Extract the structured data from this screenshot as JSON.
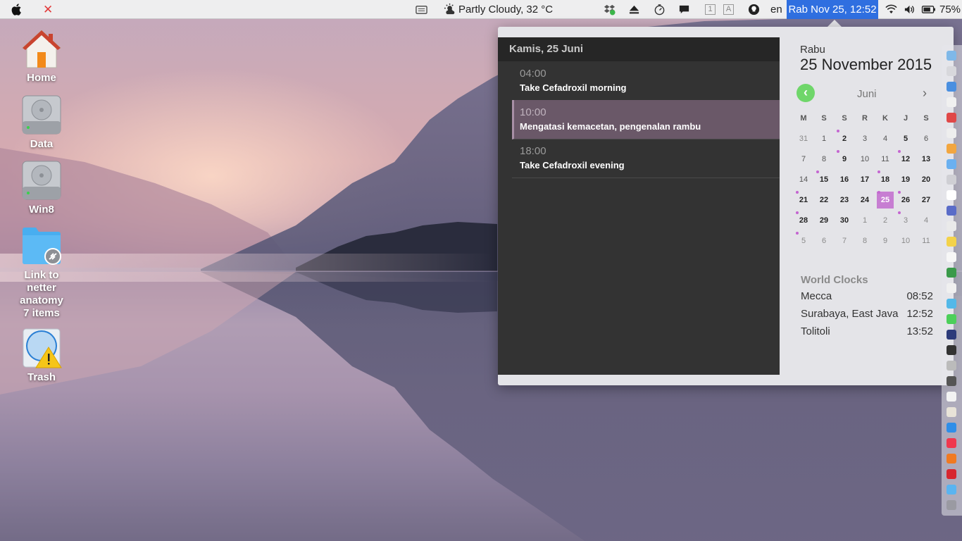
{
  "menubar": {
    "weather": "Partly Cloudy, 32 °C",
    "keyboard_1": "1",
    "keyboard_a": "A",
    "language": "en",
    "clock": "Rab Nov 25, 12:52",
    "battery": "75%"
  },
  "desktop": {
    "icons": [
      {
        "label": "Home"
      },
      {
        "label": "Data"
      },
      {
        "label": "Win8"
      },
      {
        "label": "Link to netter anatomy",
        "sub": "7 items"
      },
      {
        "label": "Trash"
      }
    ]
  },
  "events_panel": {
    "header": "Kamis, 25 Juni",
    "events": [
      {
        "time": "04:00",
        "title": "Take Cefadroxil morning"
      },
      {
        "time": "10:00",
        "title": "Mengatasi kemacetan, pengenalan rambu"
      },
      {
        "time": "18:00",
        "title": "Take Cefadroxil evening"
      }
    ]
  },
  "calendar": {
    "weekday": "Rabu",
    "full_date": "25 November 2015",
    "month": "Juni",
    "prev": "‹",
    "next": "›",
    "dow": [
      "M",
      "S",
      "S",
      "R",
      "K",
      "J",
      "S"
    ],
    "weeks": [
      [
        "31",
        "1",
        "2",
        "3",
        "4",
        "5",
        "6"
      ],
      [
        "7",
        "8",
        "9",
        "10",
        "11",
        "12",
        "13"
      ],
      [
        "14",
        "15",
        "16",
        "17",
        "18",
        "19",
        "20"
      ],
      [
        "21",
        "22",
        "23",
        "24",
        "25",
        "26",
        "27"
      ],
      [
        "28",
        "29",
        "30",
        "1",
        "2",
        "3",
        "4"
      ],
      [
        "5",
        "6",
        "7",
        "8",
        "9",
        "10",
        "11"
      ]
    ],
    "today": "25",
    "accent_color": "#c77ed2",
    "nav_color": "#6fd66a"
  },
  "world_clocks": {
    "title": "World Clocks",
    "items": [
      {
        "city": "Mecca",
        "time": "08:52"
      },
      {
        "city": "Surabaya, East Java",
        "time": "12:52"
      },
      {
        "city": "Tolitoli",
        "time": "13:52"
      }
    ]
  }
}
